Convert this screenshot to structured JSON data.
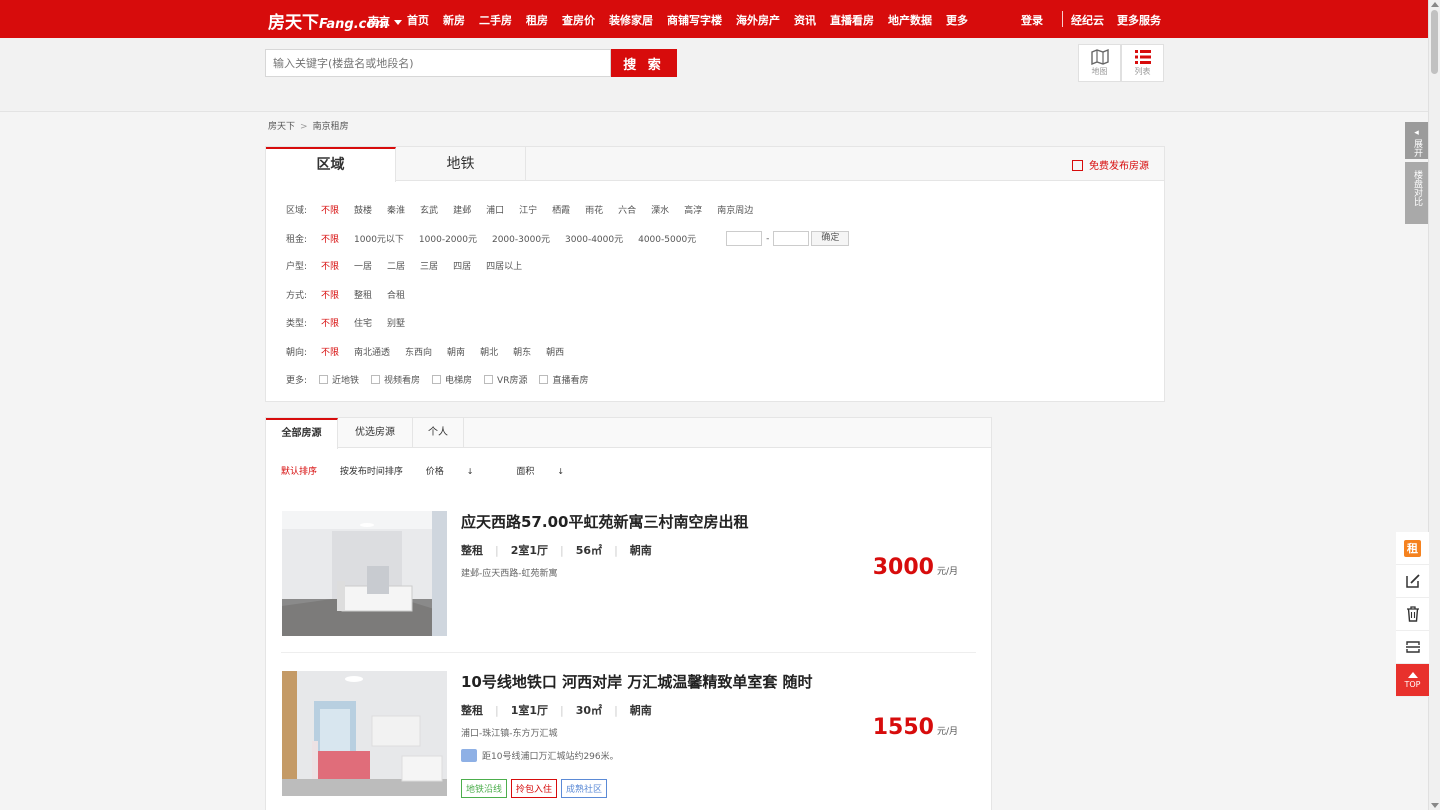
{
  "topnav": {
    "logo": "房天下",
    "logo_sub": "Fang.com",
    "city": "南京",
    "links": [
      "首页",
      "新房",
      "二手房",
      "租房",
      "查房价",
      "装修家居",
      "商铺写字楼",
      "海外房产",
      "资讯",
      "直播看房",
      "地产数据",
      "更多"
    ],
    "login": "登录",
    "agent": "经纪云",
    "more_services": "更多服务"
  },
  "search": {
    "placeholder": "输入关键字(楼盘名或地段名)",
    "button": "搜 索"
  },
  "views": {
    "map": "地图",
    "list": "列表"
  },
  "breadcrumb": [
    "房天下",
    "南京租房"
  ],
  "filter": {
    "tabs": [
      "区域",
      "地铁"
    ],
    "publish": "免费发布房源",
    "rows": [
      {
        "label": "区域:",
        "options": [
          "不限",
          "鼓楼",
          "秦淮",
          "玄武",
          "建邺",
          "浦口",
          "江宁",
          "栖霞",
          "雨花",
          "六合",
          "溧水",
          "高淳",
          "南京周边"
        ]
      },
      {
        "label": "租金:",
        "options": [
          "不限",
          "1000元以下",
          "1000-2000元",
          "2000-3000元",
          "3000-4000元",
          "4000-5000元"
        ]
      },
      {
        "label": "户型:",
        "options": [
          "不限",
          "一居",
          "二居",
          "三居",
          "四居",
          "四居以上"
        ]
      },
      {
        "label": "方式:",
        "options": [
          "不限",
          "整租",
          "合租"
        ]
      },
      {
        "label": "类型:",
        "options": [
          "不限",
          "住宅",
          "别墅"
        ]
      },
      {
        "label": "朝向:",
        "options": [
          "不限",
          "南北通透",
          "东西向",
          "朝南",
          "朝北",
          "朝东",
          "朝西"
        ]
      }
    ],
    "price_dash": "-",
    "confirm": "确定",
    "more_label": "更多:",
    "more_options": [
      "近地铁",
      "视频看房",
      "电梯房",
      "VR房源",
      "直播看房"
    ]
  },
  "listing": {
    "tabs": [
      "全部房源",
      "优选房源",
      "个人"
    ],
    "sort": [
      "默认排序",
      "按发布时间排序",
      "价格",
      "面积"
    ],
    "items": [
      {
        "title": "应天西路57.00平虹苑新寓三村南空房出租",
        "mode": "整租",
        "layout": "2室1厅",
        "area": "56㎡",
        "orient": "朝南",
        "addr": "建邺-应天西路-虹苑新寓",
        "price": "3000",
        "unit": "元/月"
      },
      {
        "title": "10号线地铁口 河西对岸 万汇城温馨精致单室套 随时",
        "mode": "整租",
        "layout": "1室1厅",
        "area": "30㎡",
        "orient": "朝南",
        "addr": "浦口-珠江镇-东方万汇城",
        "subway": "距10号线浦口万汇城站约296米。",
        "tags": [
          "地铁沿线",
          "拎包入住",
          "成熟社区"
        ],
        "price": "1550",
        "unit": "元/月"
      }
    ]
  },
  "side": {
    "expand": "展开",
    "compare": "楼盘对比",
    "rent_icon": "租",
    "top": "TOP"
  },
  "colors": {
    "brand": "#d70c0c",
    "tag_green": "#4cae4c",
    "tag_red": "#d70c0c",
    "tag_blue": "#5b8ad6"
  }
}
